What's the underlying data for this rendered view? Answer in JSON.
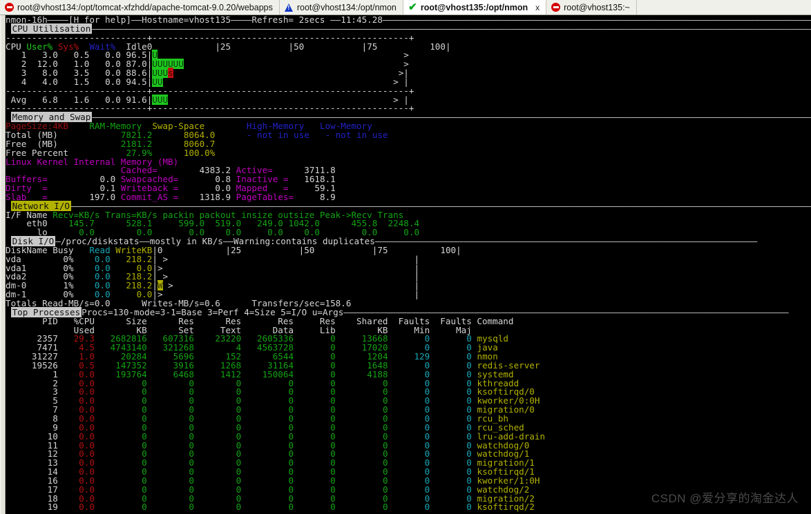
{
  "tabs": [
    {
      "label": "root@vhost134:/opt/tomcat-xfzhdd/apache-tomcat-9.0.20/webapps",
      "icon": "stop-icon",
      "active": false,
      "closable": false
    },
    {
      "label": "root@vhost134:/opt/nmon",
      "icon": "warning-icon",
      "active": false,
      "closable": false
    },
    {
      "label": "root@vhost135:/opt/nmon",
      "icon": "check-icon",
      "active": true,
      "closable": true,
      "close_label": "x"
    },
    {
      "label": "root@vhost135:~",
      "icon": "stop-icon",
      "active": false,
      "closable": false
    }
  ],
  "nmon": {
    "header": {
      "name": "nmon-16h",
      "help": "[H for help]",
      "hostname_label": "Hostname=vhost135",
      "refresh_label": "Refresh= 2secs",
      "time": "11:45.28",
      "full_line": "nmon-16h————[H for help]——Hostname=vhost135————Refresh= 2secs ——11:45.28———————————————————————————————————————————————————————————————————————————————————"
    },
    "cpu": {
      "title": "CPU Utilisation",
      "divider": "---------------------------+-------------------------------------------------+",
      "columns": [
        "CPU",
        "User%",
        "Sys%",
        "Wait%",
        "Idle"
      ],
      "scale": [
        "0",
        "|25",
        "|50",
        "|75",
        "100|"
      ],
      "rows": [
        {
          "cpu": "1",
          "user": "3.0",
          "sys": "0.5",
          "wait": "0.0",
          "idle": "96.5",
          "ubars": 1,
          "sbars": 0,
          "marker": ">",
          "tail": ""
        },
        {
          "cpu": "2",
          "user": "12.0",
          "sys": "1.0",
          "wait": "0.0",
          "idle": "87.0",
          "ubars": 6,
          "sbars": 0,
          "marker": ">",
          "tail": ""
        },
        {
          "cpu": "3",
          "user": "8.0",
          "sys": "3.5",
          "wait": "0.0",
          "idle": "88.6",
          "ubars": 3,
          "sbars": 1,
          "marker": ">",
          "tail": "|"
        },
        {
          "cpu": "4",
          "user": "4.0",
          "sys": "1.5",
          "wait": "0.0",
          "idle": "94.5",
          "ubars": 2,
          "sbars": 0,
          "marker": ">",
          "tail": " |"
        }
      ],
      "avg": {
        "cpu": "Avg",
        "user": "6.8",
        "sys": "1.6",
        "wait": "0.0",
        "idle": "91.6",
        "ubars": 3,
        "sbars": 0,
        "marker": ">",
        "tail": " |"
      }
    },
    "memory": {
      "title": "Memory and Swap",
      "pagesize": "PageSize:4KB",
      "col_headers": [
        "RAM-Memory",
        "Swap-Space",
        "High-Memory",
        "Low-Memory"
      ],
      "rows": [
        {
          "label": "Total (MB)",
          "ram": "7821.2",
          "swap": "8064.0",
          "high": "- not in use",
          "low": "- not in use"
        },
        {
          "label": "Free  (MB)",
          "ram": "2181.2",
          "swap": "8060.7",
          "high": "",
          "low": ""
        },
        {
          "label": "Free Percent",
          "ram": "27.9%",
          "swap": "100.0%",
          "high": "",
          "low": ""
        }
      ],
      "kernel_title": "Linux Kernel Internal Memory (MB)",
      "kernel": [
        {
          "l1": "",
          "v1": "",
          "l2": "Cached=",
          "v2": "4383.2",
          "l3": "Active=",
          "v3": "3711.8"
        },
        {
          "l1": "Buffers=",
          "v1": "0.0",
          "l2": "Swapcached=",
          "v2": "0.8",
          "l3": "Inactive =",
          "v3": "1618.1"
        },
        {
          "l1": "Dirty  =",
          "v1": "0.1",
          "l2": "Writeback =",
          "v2": "0.0",
          "l3": "Mapped   =",
          "v3": "59.1"
        },
        {
          "l1": "Slab   =",
          "v1": "197.0",
          "l2": "Commit_AS =",
          "v2": "1318.9",
          "l3": "PageTables=",
          "v3": "8.9"
        }
      ]
    },
    "network": {
      "title": "Network I/O",
      "columns": "I/F Name Recv=KB/s Trans=KB/s packin packout insize outsize Peak->Recv Trans",
      "col_labels": [
        "I/F Name",
        "Recv=KB/s",
        "Trans=KB/s",
        "packin",
        "packout",
        "insize",
        "outsize",
        "Peak->Recv",
        "Trans"
      ],
      "rows": [
        {
          "name": "eth0",
          "recv": "145.7",
          "trans": "528.1",
          "packin": "599.0",
          "packout": "519.0",
          "insize": "249.0",
          "outsize": "1042.0",
          "peak_recv": "455.8",
          "peak_trans": "2248.4"
        },
        {
          "name": "lo",
          "recv": "0.0",
          "trans": "0.0",
          "packin": "0.0",
          "packout": "0.0",
          "insize": "0.0",
          "outsize": "0.0",
          "peak_recv": "0.0",
          "peak_trans": "0.0"
        }
      ]
    },
    "disk": {
      "title": "Disk I/O",
      "subtitle": "—/proc/diskstats——mostly in KB/s——Warning:contains duplicates—————————————————————————————————————————————————————————————————————————",
      "columns": [
        "DiskName",
        "Busy",
        "Read",
        "WriteKB"
      ],
      "scale": [
        "0",
        "|25",
        "|50",
        "|75",
        "100|"
      ],
      "rows": [
        {
          "name": "vda",
          "busy": "0%",
          "read": "0.0",
          "write": "218.2",
          "wbars": 0,
          "marker": " >",
          "tail": "|"
        },
        {
          "name": "vda1",
          "busy": "0%",
          "read": "0.0",
          "write": "0.0",
          "wbars": 0,
          "marker": ">",
          "tail": "|"
        },
        {
          "name": "vda2",
          "busy": "0%",
          "read": "0.0",
          "write": "218.2",
          "wbars": 0,
          "marker": " >",
          "tail": "|"
        },
        {
          "name": "dm-0",
          "busy": "1%",
          "read": "0.0",
          "write": "218.2",
          "wbars": 1,
          "marker": " >",
          "tail": "|"
        },
        {
          "name": "dm-1",
          "busy": "0%",
          "read": "0.0",
          "write": "0.0",
          "wbars": 0,
          "marker": ">",
          "tail": "|"
        }
      ],
      "totals": "Totals Read-MB/s=0.0      Writes-MB/s=0.6      Transfers/sec=158.6"
    },
    "procs": {
      "title": "Top Processes",
      "subtitle": "Procs=130-mode=3-1=Base 3=Perf 4=Size 5=I/O u=Args—————————————————————————————————————————————————————————————————————————————————————",
      "header1": [
        "PID",
        "%CPU",
        "Size",
        "Res",
        "Res",
        "Res",
        "Res",
        "Shared",
        "Faults",
        "Faults",
        "Command"
      ],
      "header2": [
        "",
        "Used",
        "KB",
        "Set",
        "Text",
        "Data",
        "Lib",
        "KB",
        "Min",
        "Maj",
        ""
      ],
      "rows": [
        {
          "pid": "2357",
          "cpu": "29.3",
          "size": "2682816",
          "res_set": "607316",
          "res_text": "23220",
          "res_data": "2605336",
          "res_lib": "0",
          "shared": "13668",
          "min": "0",
          "maj": "0",
          "command": "mysqld"
        },
        {
          "pid": "7471",
          "cpu": "4.5",
          "size": "4743140",
          "res_set": "321268",
          "res_text": "4",
          "res_data": "4563728",
          "res_lib": "0",
          "shared": "17020",
          "min": "0",
          "maj": "0",
          "command": "java"
        },
        {
          "pid": "31227",
          "cpu": "1.0",
          "size": "20284",
          "res_set": "5696",
          "res_text": "152",
          "res_data": "6544",
          "res_lib": "0",
          "shared": "1204",
          "min": "129",
          "maj": "0",
          "command": "nmon"
        },
        {
          "pid": "19526",
          "cpu": "0.5",
          "size": "147352",
          "res_set": "3916",
          "res_text": "1268",
          "res_data": "31164",
          "res_lib": "0",
          "shared": "1648",
          "min": "0",
          "maj": "0",
          "command": "redis-server"
        },
        {
          "pid": "1",
          "cpu": "0.0",
          "size": "193764",
          "res_set": "6468",
          "res_text": "1412",
          "res_data": "150064",
          "res_lib": "0",
          "shared": "4188",
          "min": "0",
          "maj": "0",
          "command": "systemd"
        },
        {
          "pid": "2",
          "cpu": "0.0",
          "size": "0",
          "res_set": "0",
          "res_text": "0",
          "res_data": "0",
          "res_lib": "0",
          "shared": "0",
          "min": "0",
          "maj": "0",
          "command": "kthreadd"
        },
        {
          "pid": "3",
          "cpu": "0.0",
          "size": "0",
          "res_set": "0",
          "res_text": "0",
          "res_data": "0",
          "res_lib": "0",
          "shared": "0",
          "min": "0",
          "maj": "0",
          "command": "ksoftirqd/0"
        },
        {
          "pid": "5",
          "cpu": "0.0",
          "size": "0",
          "res_set": "0",
          "res_text": "0",
          "res_data": "0",
          "res_lib": "0",
          "shared": "0",
          "min": "0",
          "maj": "0",
          "command": "kworker/0:0H"
        },
        {
          "pid": "7",
          "cpu": "0.0",
          "size": "0",
          "res_set": "0",
          "res_text": "0",
          "res_data": "0",
          "res_lib": "0",
          "shared": "0",
          "min": "0",
          "maj": "0",
          "command": "migration/0"
        },
        {
          "pid": "8",
          "cpu": "0.0",
          "size": "0",
          "res_set": "0",
          "res_text": "0",
          "res_data": "0",
          "res_lib": "0",
          "shared": "0",
          "min": "0",
          "maj": "0",
          "command": "rcu_bh"
        },
        {
          "pid": "9",
          "cpu": "0.0",
          "size": "0",
          "res_set": "0",
          "res_text": "0",
          "res_data": "0",
          "res_lib": "0",
          "shared": "0",
          "min": "0",
          "maj": "0",
          "command": "rcu_sched"
        },
        {
          "pid": "10",
          "cpu": "0.0",
          "size": "0",
          "res_set": "0",
          "res_text": "0",
          "res_data": "0",
          "res_lib": "0",
          "shared": "0",
          "min": "0",
          "maj": "0",
          "command": "lru-add-drain"
        },
        {
          "pid": "11",
          "cpu": "0.0",
          "size": "0",
          "res_set": "0",
          "res_text": "0",
          "res_data": "0",
          "res_lib": "0",
          "shared": "0",
          "min": "0",
          "maj": "0",
          "command": "watchdog/0"
        },
        {
          "pid": "12",
          "cpu": "0.0",
          "size": "0",
          "res_set": "0",
          "res_text": "0",
          "res_data": "0",
          "res_lib": "0",
          "shared": "0",
          "min": "0",
          "maj": "0",
          "command": "watchdog/1"
        },
        {
          "pid": "13",
          "cpu": "0.0",
          "size": "0",
          "res_set": "0",
          "res_text": "0",
          "res_data": "0",
          "res_lib": "0",
          "shared": "0",
          "min": "0",
          "maj": "0",
          "command": "migration/1"
        },
        {
          "pid": "14",
          "cpu": "0.0",
          "size": "0",
          "res_set": "0",
          "res_text": "0",
          "res_data": "0",
          "res_lib": "0",
          "shared": "0",
          "min": "0",
          "maj": "0",
          "command": "ksoftirqd/1"
        },
        {
          "pid": "16",
          "cpu": "0.0",
          "size": "0",
          "res_set": "0",
          "res_text": "0",
          "res_data": "0",
          "res_lib": "0",
          "shared": "0",
          "min": "0",
          "maj": "0",
          "command": "kworker/1:0H"
        },
        {
          "pid": "17",
          "cpu": "0.0",
          "size": "0",
          "res_set": "0",
          "res_text": "0",
          "res_data": "0",
          "res_lib": "0",
          "shared": "0",
          "min": "0",
          "maj": "0",
          "command": "watchdog/2"
        },
        {
          "pid": "18",
          "cpu": "0.0",
          "size": "0",
          "res_set": "0",
          "res_text": "0",
          "res_data": "0",
          "res_lib": "0",
          "shared": "0",
          "min": "0",
          "maj": "0",
          "command": "migration/2"
        },
        {
          "pid": "19",
          "cpu": "0.0",
          "size": "0",
          "res_set": "0",
          "res_text": "0",
          "res_data": "0",
          "res_lib": "0",
          "shared": "0",
          "min": "0",
          "maj": "0",
          "command": "ksoftirqd/2"
        }
      ]
    }
  },
  "watermark": "CSDN @爱分享的淘金达人"
}
